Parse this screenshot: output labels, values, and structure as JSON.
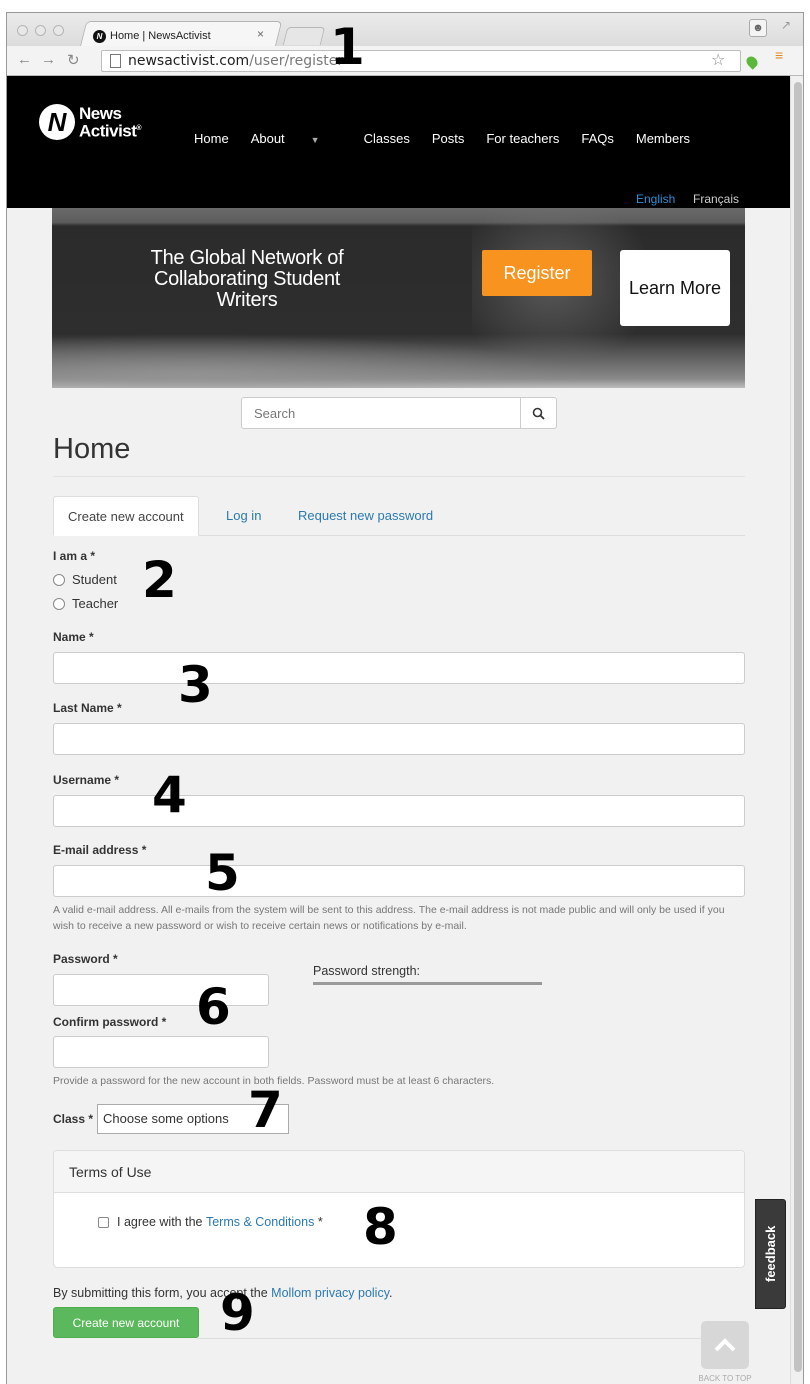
{
  "browser": {
    "tab_title": "Home | NewsActivist",
    "tab_close": "×",
    "url_host": "newsactivist.com",
    "url_path": "/user/register"
  },
  "header": {
    "logo_line1": "News",
    "logo_line2": "Activist",
    "nav": [
      "Home",
      "About",
      "Classes",
      "Posts",
      "For teachers",
      "FAQs",
      "Members"
    ],
    "lang_en": "English",
    "lang_fr": "Français",
    "lang_en_color": "#2a8fd6"
  },
  "hero": {
    "title": "The Global Network of Collaborating Student Writers",
    "register_label": "Register",
    "learn_label": "Learn More",
    "register_color": "#f7931e"
  },
  "search": {
    "placeholder": "Search"
  },
  "page": {
    "title": "Home"
  },
  "tabs": [
    "Create new account",
    "Log in",
    "Request new password"
  ],
  "form": {
    "role_label": "I am a *",
    "role_options": [
      "Student",
      "Teacher"
    ],
    "name_label": "Name *",
    "last_name_label": "Last Name *",
    "username_label": "Username *",
    "email_label": "E-mail address *",
    "email_help": "A valid e-mail address. All e-mails from the system will be sent to this address. The e-mail address is not made public and will only be used if you wish to receive a new password or wish to receive certain news or notifications by e-mail.",
    "password_label": "Password *",
    "password_strength": "Password strength:",
    "confirm_label": "Confirm password *",
    "password_help": "Provide a password for the new account in both fields. Password must be at least 6 characters.",
    "class_label": "Class *",
    "class_value": "Choose some options",
    "terms_title": "Terms of Use",
    "terms_prefix": "I agree with the",
    "terms_link": "Terms & Conditions",
    "terms_suffix": "*",
    "privacy_prefix": "By submitting this form, you accept the",
    "privacy_link": "Mollom privacy policy",
    "privacy_suffix": ".",
    "submit_label": "Create new account",
    "submit_color": "#5cb85c"
  },
  "feedback_label": "feedback",
  "back_to_top": "BACK TO TOP",
  "annotations": [
    "1",
    "2",
    "3",
    "4",
    "5",
    "6",
    "7",
    "8",
    "9"
  ]
}
